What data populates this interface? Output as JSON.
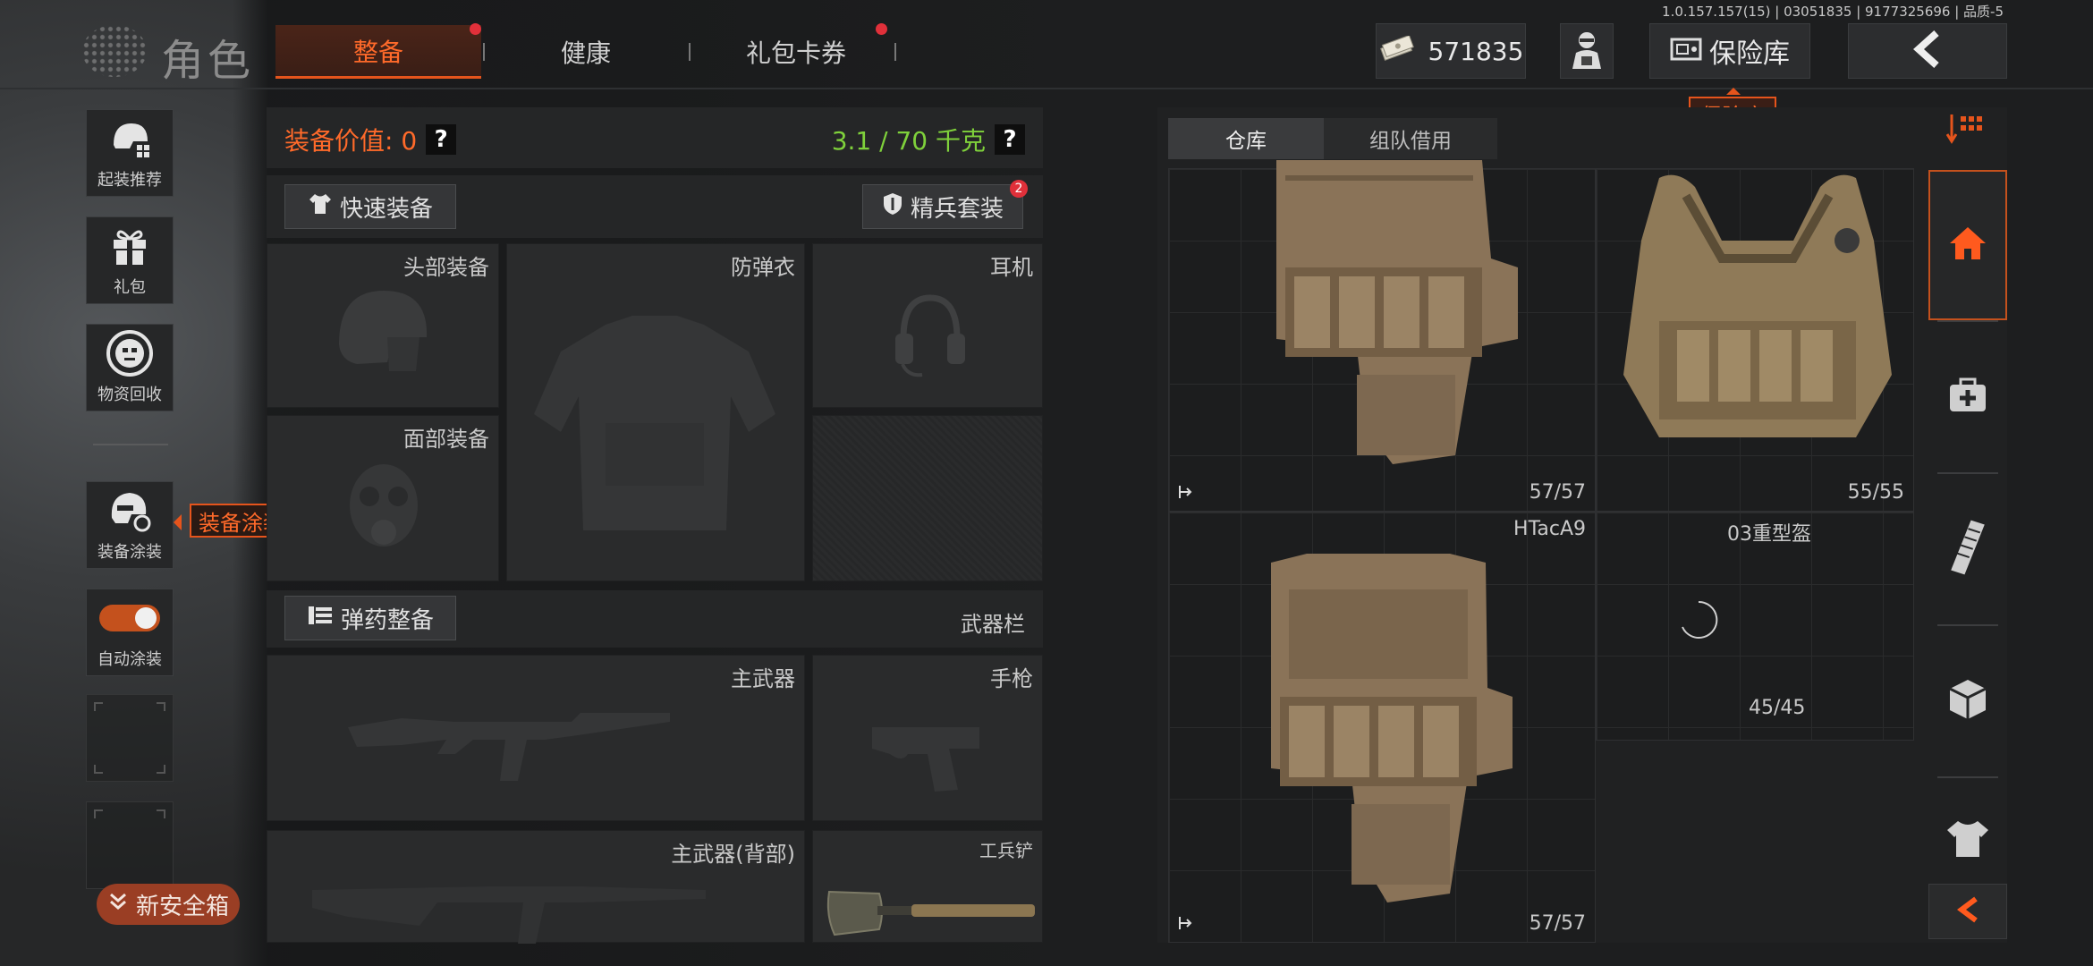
{
  "version": "1.0.157.157(15) | 03051835 | 9177325696 | 品质-5",
  "header": {
    "title": "角色",
    "tabs": [
      {
        "label": "整备",
        "active": true,
        "dot": true
      },
      {
        "label": "健康",
        "active": false,
        "dot": false
      },
      {
        "label": "礼包卡券",
        "active": false,
        "dot": true
      }
    ],
    "currency": "571835",
    "vault_label": "保险库",
    "vault_tooltip": "保险库"
  },
  "sidebar": {
    "items": [
      {
        "label": "起装推荐",
        "icon": "helmet-icon"
      },
      {
        "label": "礼包",
        "icon": "gift-icon"
      },
      {
        "label": "物资回收",
        "icon": "recycle-icon"
      },
      {
        "label": "装备涂装",
        "icon": "skin-icon"
      },
      {
        "label": "自动涂装",
        "icon": "toggle-switch",
        "toggle_on": true
      }
    ],
    "skin_tooltip": "装备涂装",
    "safebox_label": "新安全箱"
  },
  "loadout": {
    "value_label": "装备价值: 0",
    "weight_label": "3.1 / 70 千克",
    "quick_equip": "快速装备",
    "elite_kit": "精兵套装",
    "elite_badge": "2",
    "slots": {
      "head": "头部装备",
      "armor": "防弹衣",
      "headset": "耳机",
      "face": "面部装备"
    },
    "ammo_button": "弹药整备",
    "weapon_bar": "武器栏",
    "weapon_slots": {
      "primary": "主武器",
      "pistol": "手枪",
      "primary_back": "主武器(背部)",
      "shovel": "工兵铲"
    }
  },
  "storage": {
    "tabs": [
      {
        "label": "仓库",
        "active": true
      },
      {
        "label": "组队借用",
        "active": false
      }
    ],
    "items": [
      {
        "name": "",
        "count": "57/57"
      },
      {
        "name": "",
        "count": "55/55"
      },
      {
        "name": "HTacA9",
        "count": "57/57"
      },
      {
        "name": "03重型盔",
        "count": "45/45"
      }
    ]
  },
  "colors": {
    "accent": "#e5541c",
    "weight_green": "#7fd13b",
    "background": "#1d1e1f"
  }
}
